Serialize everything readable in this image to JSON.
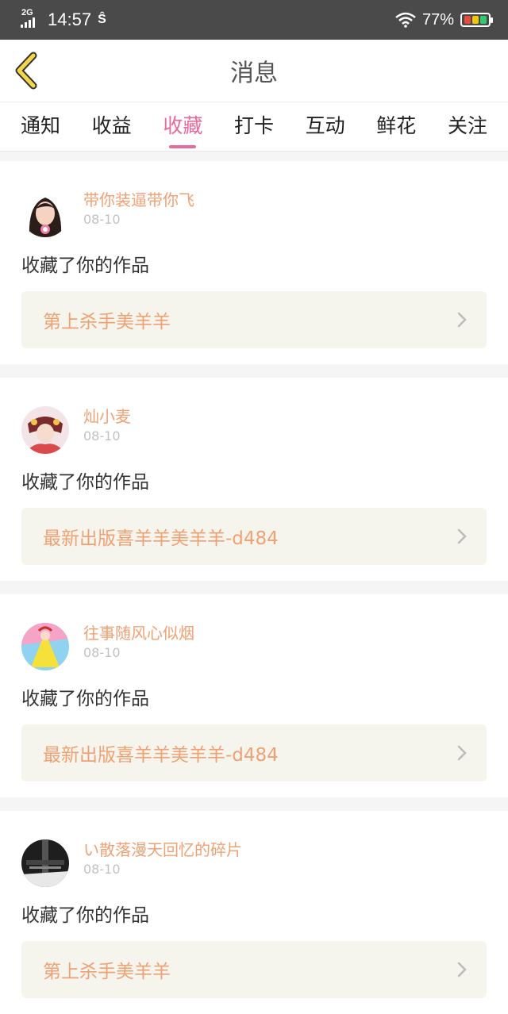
{
  "status_bar": {
    "network": "2G",
    "time": "14:57",
    "extra": "Ŝ",
    "battery": "77%"
  },
  "header": {
    "title": "消息"
  },
  "tabs": [
    {
      "label": "通知"
    },
    {
      "label": "收益"
    },
    {
      "label": "收藏",
      "active": true
    },
    {
      "label": "打卡"
    },
    {
      "label": "互动"
    },
    {
      "label": "鲜花"
    },
    {
      "label": "关注"
    }
  ],
  "items": [
    {
      "username": "带你装逼带你飞",
      "date": "08-10",
      "action": "收藏了你的作品",
      "work": "第上杀手美羊羊"
    },
    {
      "username": "灿小麦",
      "date": "08-10",
      "action": "收藏了你的作品",
      "work": "最新出版喜羊羊美羊羊-d484"
    },
    {
      "username": "往事随风心似烟",
      "date": "08-10",
      "action": "收藏了你的作品",
      "work": "最新出版喜羊羊美羊羊-d484"
    },
    {
      "username": "い散落漫天回忆的碎片",
      "date": "08-10",
      "action": "收藏了你的作品",
      "work": "第上杀手美羊羊"
    }
  ],
  "colors": {
    "accent_pink": "#e86a9b",
    "username_orange": "#f0a174",
    "work_bg": "#f5f5ee",
    "statusbar_bg": "#4a4a4a"
  }
}
